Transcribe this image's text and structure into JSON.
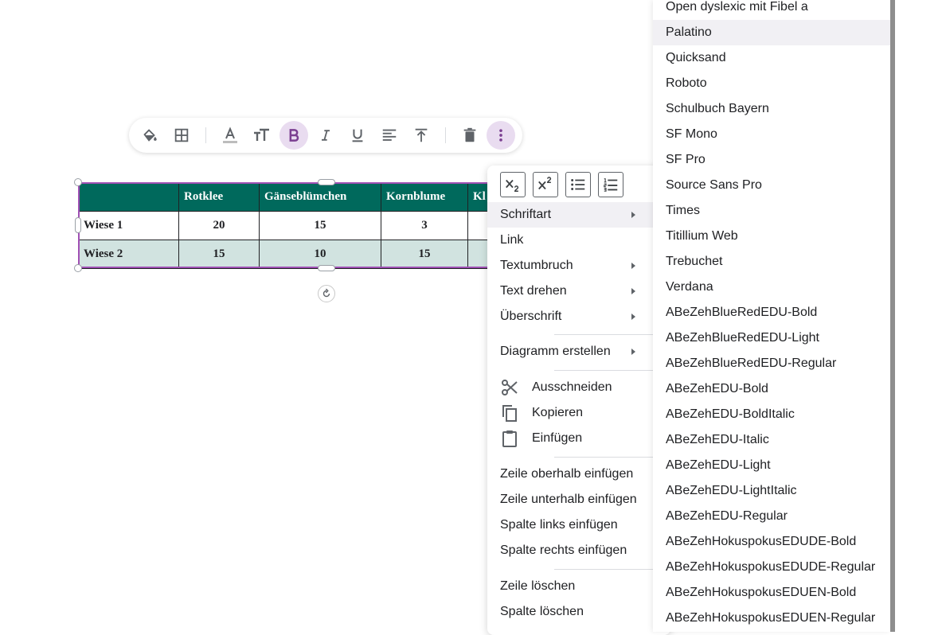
{
  "toolbar": {
    "buttons": [
      {
        "name": "fill-color-button",
        "icon": "paint-bucket-icon"
      },
      {
        "name": "table-borders-button",
        "icon": "grid-icon"
      },
      {
        "name": "text-color-button",
        "icon": "text-color-icon"
      },
      {
        "name": "font-size-button",
        "icon": "font-size-icon"
      },
      {
        "name": "bold-button",
        "icon": "bold-icon",
        "active": true
      },
      {
        "name": "italic-button",
        "icon": "italic-icon"
      },
      {
        "name": "underline-button",
        "icon": "underline-icon"
      },
      {
        "name": "align-left-button",
        "icon": "align-left-icon"
      },
      {
        "name": "vertical-align-top-button",
        "icon": "vertical-align-top-icon"
      },
      {
        "name": "delete-button",
        "icon": "trash-icon"
      },
      {
        "name": "more-options-button",
        "icon": "more-vert-icon",
        "active": true
      }
    ],
    "accent_color": "#7b3f91"
  },
  "table": {
    "header": [
      "",
      "Rotklee",
      "Gänseblümchen",
      "Kornblume",
      "Kl"
    ],
    "rows": [
      [
        "Wiese 1",
        "20",
        "15",
        "3",
        ""
      ],
      [
        "Wiese 2",
        "15",
        "10",
        "15",
        ""
      ]
    ],
    "header_color": "#00695c",
    "stripe_color": "#d1e3e0"
  },
  "context_menu": {
    "icon_buttons": [
      "subscript-icon",
      "superscript-icon",
      "bulleted-list-icon",
      "numbered-list-icon"
    ],
    "items": {
      "schriftart": "Schriftart",
      "link": "Link",
      "textumbruch": "Textumbruch",
      "text_drehen": "Text drehen",
      "ueberschrift": "Überschrift",
      "diagramm": "Diagramm erstellen",
      "ausschneiden": "Ausschneiden",
      "kopieren": "Kopieren",
      "einfuegen": "Einfügen",
      "zeile_oberhalb": "Zeile oberhalb einfügen",
      "zeile_unterhalb": "Zeile unterhalb einfügen",
      "spalte_links": "Spalte links einfügen",
      "spalte_rechts": "Spalte rechts einfügen",
      "zeile_loeschen": "Zeile löschen",
      "spalte_loeschen": "Spalte löschen"
    }
  },
  "font_menu": {
    "fonts": [
      "Open dyslexic mit Fibel a",
      "Palatino",
      "Quicksand",
      "Roboto",
      "Schulbuch Bayern",
      "SF Mono",
      "SF Pro",
      "Source Sans Pro",
      "Times",
      "Titillium Web",
      "Trebuchet",
      "Verdana",
      "ABeZehBlueRedEDU-Bold",
      "ABeZehBlueRedEDU-Light",
      "ABeZehBlueRedEDU-Regular",
      "ABeZehEDU-Bold",
      "ABeZehEDU-BoldItalic",
      "ABeZehEDU-Italic",
      "ABeZehEDU-Light",
      "ABeZehEDU-LightItalic",
      "ABeZehEDU-Regular",
      "ABeZehHokuspokusEDUDE-Bold",
      "ABeZehHokuspokusEDUDE-Regular",
      "ABeZehHokuspokusEDUEN-Bold",
      "ABeZehHokuspokusEDUEN-Regular"
    ],
    "highlighted": "Palatino"
  }
}
